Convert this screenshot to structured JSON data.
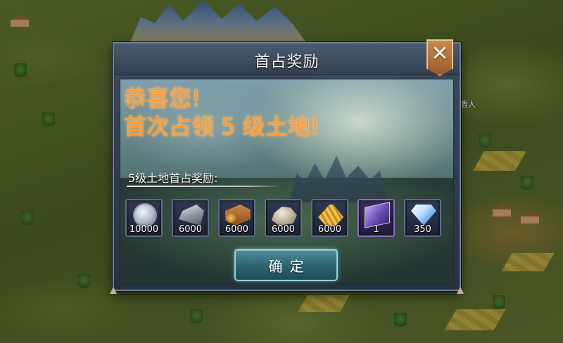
{
  "map": {
    "label": "盾人"
  },
  "dialog": {
    "title": "首占奖励",
    "close_symbol": "✕",
    "congrats_line1": "恭喜您!",
    "congrats_line2": "首次占领 5 级土地!",
    "reward_label": "5级土地首占奖励:",
    "confirm_label": "确定"
  },
  "rewards": [
    {
      "icon": "silver-coin-icon",
      "count": "10000"
    },
    {
      "icon": "iron-ingot-icon",
      "count": "6000"
    },
    {
      "icon": "wood-log-icon",
      "count": "6000"
    },
    {
      "icon": "stone-icon",
      "count": "6000"
    },
    {
      "icon": "wheat-icon",
      "count": "6000"
    },
    {
      "icon": "purple-book-icon",
      "count": "1"
    },
    {
      "icon": "diamond-icon",
      "count": "350"
    }
  ],
  "colors": {
    "congrats_text": "#ff9b3a",
    "close_button": "#b06f3a",
    "confirm_button": "#2e6672",
    "purple_slot_border": "#8a6fc2"
  }
}
